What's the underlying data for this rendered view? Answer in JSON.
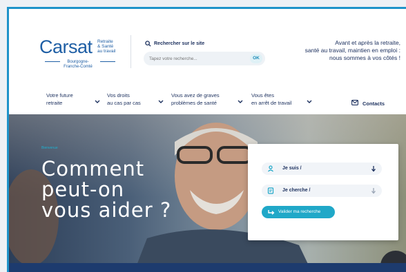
{
  "header": {
    "logo": {
      "name": "Carsat",
      "subtitle_lines": [
        "Retraite",
        "& Santé",
        "au travail"
      ],
      "region_lines": [
        "Bourgogne-",
        "Franche-Comté"
      ]
    },
    "search": {
      "label": "Rechercher sur le site",
      "placeholder": "Tapez votre recherche...",
      "submit_label": "OK"
    },
    "tagline_lines": [
      "Avant et après la retraite,",
      "santé au travail, maintien en emploi :",
      "nous sommes à vos côtés !"
    ]
  },
  "nav": {
    "items": [
      {
        "line1": "Votre future",
        "line2": "retraite"
      },
      {
        "line1": "Vos droits",
        "line2": "au cas par cas"
      },
      {
        "line1": "Vous avez de graves",
        "line2": "problèmes de santé"
      },
      {
        "line1": "Vous êtes",
        "line2": "en arrêt de travail"
      }
    ],
    "contacts_label": "Contacts"
  },
  "hero": {
    "eyebrow": "Bienvenue",
    "title_lines": [
      "Comment",
      "peut-on",
      "vous aider ?"
    ]
  },
  "helper": {
    "select_1": "Je suis /",
    "select_2": "Je cherche /",
    "submit_label": "Valider ma recherche"
  },
  "colors": {
    "brand_blue": "#1f5fa5",
    "navy": "#1b2f5d",
    "accent_cyan": "#20a8c8"
  },
  "icons": [
    "search-icon",
    "chevron-down-icon",
    "mail-icon",
    "person-icon",
    "document-icon",
    "arrow-down-icon",
    "return-arrow-icon"
  ]
}
